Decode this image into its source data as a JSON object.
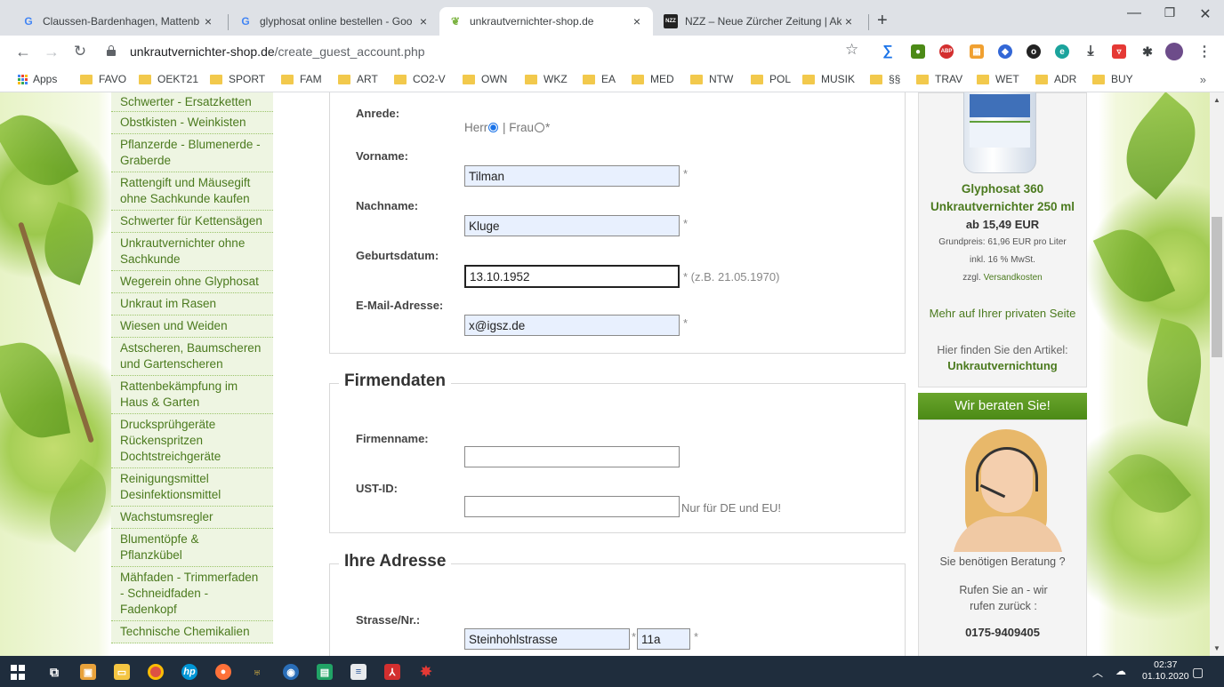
{
  "browser": {
    "tabs": [
      {
        "title": "Claussen-Bardenhagen, Mattenb",
        "favicon": "G",
        "active": false
      },
      {
        "title": "glyphosat online bestellen - Goo",
        "favicon": "G",
        "active": false
      },
      {
        "title": "unkrautvernichter-shop.de",
        "favicon": "leaf",
        "active": true
      },
      {
        "title": "NZZ – Neue Zürcher Zeitung | Ak",
        "favicon": "NZZ",
        "active": false
      }
    ],
    "url_host": "unkrautvernichter-shop.de",
    "url_path": "/create_guest_account.php",
    "bookmarks": [
      "Apps",
      "FAVO",
      "OEKT21",
      "SPORT",
      "FAM",
      "ART",
      "CO2-V",
      "OWN",
      "WKZ",
      "EA",
      "MED",
      "NTW",
      "POL",
      "MUSIK",
      "§§",
      "TRAV",
      "WET",
      "ADR",
      "BUY"
    ],
    "bookmarks_more": "»"
  },
  "sidebar": {
    "items": [
      "Schwerter - Ersatzketten",
      "Obstkisten - Weinkisten",
      "Pflanzerde - Blumenerde - Graberde",
      "Rattengift und Mäusegift ohne Sachkunde kaufen",
      "Schwerter für Kettensägen",
      "Unkrautvernichter ohne Sachkunde",
      "Wegerein ohne Glyphosat",
      "Unkraut im Rasen",
      "Wiesen und Weiden",
      "Astscheren, Baumscheren und Gartenscheren",
      "Rattenbekämpfung im Haus & Garten",
      "Drucksprühgeräte Rückenspritzen Dochtstreichgeräte",
      "Reinigungsmittel Desinfektionsmittel",
      "Wachstumsregler",
      "Blumentöpfe & Pflanzkübel",
      "Mähfaden - Trimmerfaden - Schneidfaden - Fadenkopf",
      "Technische Chemikalien"
    ]
  },
  "form": {
    "anrede_label": "Anrede:",
    "anrede_herr": "Herr",
    "anrede_sep": " | Frau",
    "anrede_star": "*",
    "vorname_label": "Vorname:",
    "vorname_value": "Tilman",
    "nachname_label": "Nachname:",
    "nachname_value": "Kluge",
    "geburt_label": "Geburtsdatum:",
    "geburt_value": "13.10.1952",
    "geburt_hint": "* (z.B. 21.05.1970)",
    "email_label": "E-Mail-Adresse:",
    "email_value": "x@igsz.de",
    "required": "*",
    "firma_legend": "Firmendaten",
    "firmenname_label": "Firmenname:",
    "ustid_label": "UST-ID:",
    "ustid_hint": "Nur für DE und EU!",
    "adresse_legend": "Ihre Adresse",
    "strasse_label": "Strasse/Nr.:",
    "strasse_value": "Steinhohlstrasse",
    "hausnr_value": "11a"
  },
  "product": {
    "name": "Glyphosat 360 Unkrautvernichter 250 ml",
    "price": "ab 15,49 EUR",
    "grundpreis": "Grundpreis: 61,96 EUR pro Liter",
    "mwst": "inkl. 16 % MwSt.",
    "versand_prefix": "zzgl.",
    "versand_link": "Versandkosten",
    "more_link": "Mehr auf Ihrer privaten Seite",
    "find_text": "Hier finden Sie den Artikel:",
    "find_link": "Unkrautvernichtung"
  },
  "advice": {
    "header": "Wir beraten Sie!",
    "question": "Sie benötigen Beratung ?",
    "call": "Rufen Sie an - wir rufen zurück :",
    "phone": "0175-9409405"
  },
  "taskbar": {
    "time": "02:37",
    "date": "01.10.2020"
  }
}
